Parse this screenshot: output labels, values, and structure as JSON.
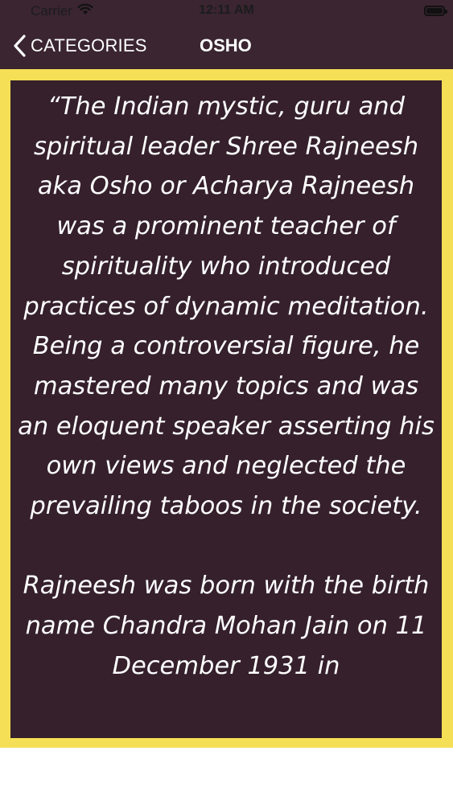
{
  "status_bar": {
    "carrier": "Carrier",
    "time": "12:11 AM",
    "wifi_icon": "wifi-icon",
    "battery_icon": "battery-icon"
  },
  "nav": {
    "back_label": "CATEGORIES",
    "title": "OSHO",
    "back_icon": "chevron-left-icon"
  },
  "content": {
    "paragraph_1": "“The Indian mystic, guru and spiritual leader Shree Rajneesh aka Osho or Acharya Rajneesh was a prominent teacher of spirituality who introduced practices of dynamic meditation. Being a controversial figure, he mastered many topics and was an eloquent speaker asserting his own views and neglected the prevailing taboos in the society.",
    "paragraph_2": "Rajneesh was born with the birth name Chandra Mohan Jain on 11 December 1931 in"
  },
  "colors": {
    "nav_background": "#3a2530",
    "frame_border": "#f5df56",
    "content_background": "#35202c",
    "text": "#ffffff"
  }
}
